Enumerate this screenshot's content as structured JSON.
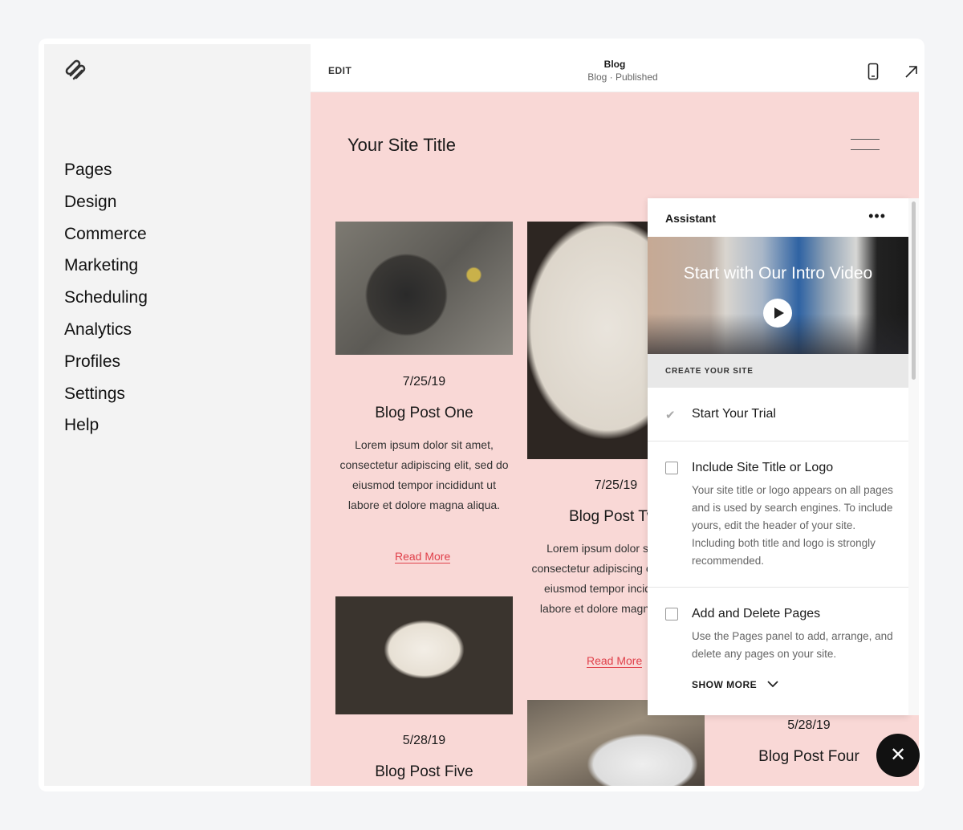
{
  "sidebar": {
    "items": [
      {
        "label": "Pages"
      },
      {
        "label": "Design"
      },
      {
        "label": "Commerce"
      },
      {
        "label": "Marketing"
      },
      {
        "label": "Scheduling"
      },
      {
        "label": "Analytics"
      },
      {
        "label": "Profiles"
      },
      {
        "label": "Settings"
      },
      {
        "label": "Help"
      }
    ]
  },
  "topbar": {
    "edit": "EDIT",
    "title": "Blog",
    "subtitle": "Blog · Published"
  },
  "site": {
    "title": "Your Site Title"
  },
  "posts": [
    {
      "date": "7/25/19",
      "title": "Blog Post One",
      "body": "Lorem ipsum dolor sit amet, consectetur adipiscing elit, sed do eiusmod tempor incididunt ut labore et dolore magna aliqua.",
      "read_more": "Read More"
    },
    {
      "date": "7/25/19",
      "title": "Blog Post Two",
      "body": "Lorem ipsum dolor sit amet, consectetur adipiscing elit, sed do eiusmod tempor incididunt ut labore et dolore magna aliqua.",
      "read_more": "Read More"
    },
    {
      "date": "5/28/19",
      "title": "Blog Post Five"
    },
    {
      "date": "5/28/19",
      "title": "Blog Post Four"
    }
  ],
  "assistant": {
    "title": "Assistant",
    "video_title": "Start with Our Intro Video",
    "section": "CREATE YOUR SITE",
    "tasks": [
      {
        "title": "Start Your Trial",
        "done": true
      },
      {
        "title": "Include Site Title or Logo",
        "done": false,
        "desc": "Your site title or logo appears on all pages and is used by search engines. To include yours, edit the header of your site. Including both title and logo is strongly recommended."
      },
      {
        "title": "Add and Delete Pages",
        "done": false,
        "desc": "Use the Pages panel to add, arrange, and delete any pages on your site."
      }
    ],
    "show_more": "SHOW MORE"
  },
  "colors": {
    "preview_bg": "#f9d8d6",
    "link": "#e0404a"
  }
}
